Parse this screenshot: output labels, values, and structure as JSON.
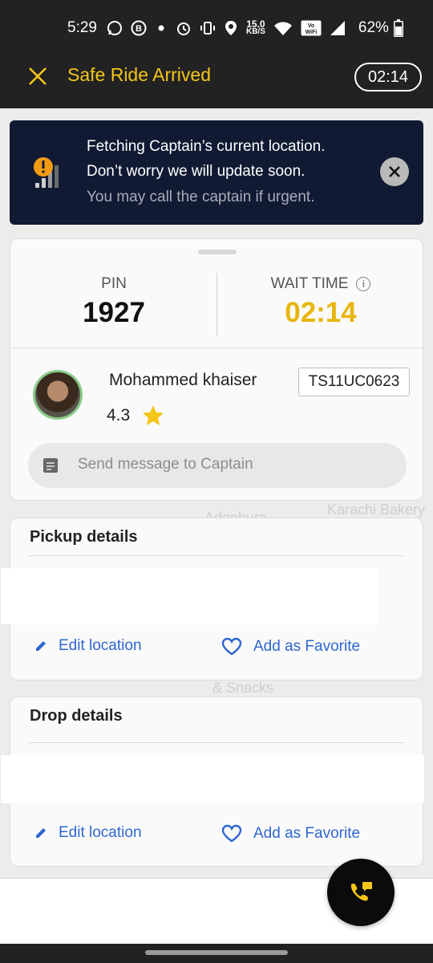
{
  "status_bar": {
    "time": "5:29",
    "network_speed_value": "15.0",
    "network_speed_unit": "KB/S",
    "wifi_badge": "Vo WiFi",
    "battery": "62%"
  },
  "app_bar": {
    "title": "Safe Ride Arrived",
    "timer": "02:14"
  },
  "map_labels": [
    "Adephura",
    "Karachi Bakery",
    "& Snacks"
  ],
  "notice": {
    "line1": "Fetching Captain’s current location.",
    "line2": "Don’t worry we will update soon.",
    "line3": "You may call the captain if urgent."
  },
  "trip": {
    "pin_label": "PIN",
    "pin_value": "1927",
    "wait_label": "WAIT TIME",
    "wait_value": "02:14"
  },
  "captain": {
    "name": "Mohammed khaiser",
    "vehicle_plate": "TS11UC0623",
    "rating": "4.3",
    "message_placeholder": "Send message to Captain"
  },
  "pickup": {
    "title": "Pickup details",
    "edit_label": "Edit location",
    "favorite_label": "Add as Favorite"
  },
  "drop": {
    "title": "Drop details",
    "edit_label": "Edit location",
    "favorite_label": "Add as Favorite"
  },
  "colors": {
    "accent_yellow": "#f5c518",
    "wait_time_yellow": "#e8b50c",
    "link_blue": "#2f66d0",
    "notice_bg": "#111a33",
    "bar_dark": "#222222"
  },
  "icons": {
    "close": "close-icon",
    "signal_warning": "signal-warning-icon",
    "dismiss": "dismiss-icon",
    "info": "info-icon",
    "star": "star-icon",
    "message": "message-icon",
    "edit": "pencil-icon",
    "favorite": "heart-icon",
    "call": "call-icon"
  }
}
